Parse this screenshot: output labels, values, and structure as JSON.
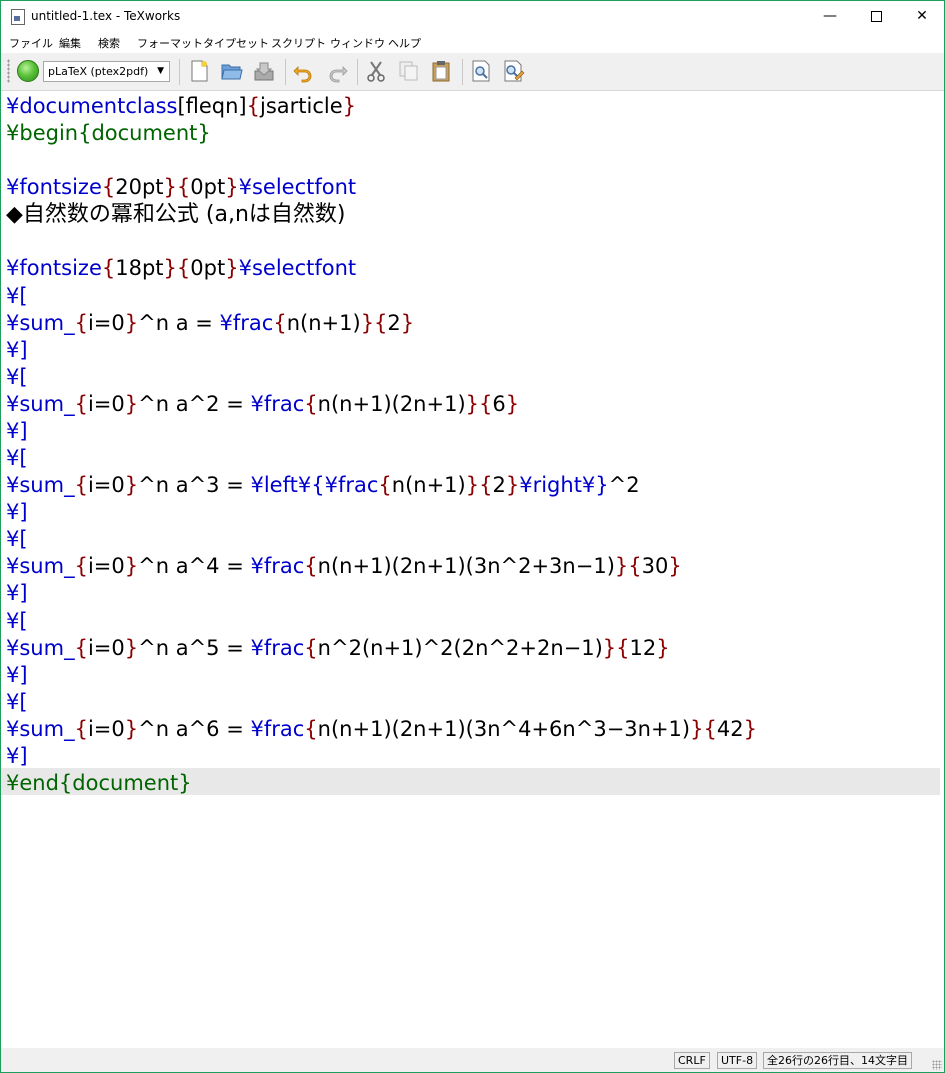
{
  "window": {
    "title": "untitled-1.tex - TeXworks",
    "minimize": "—",
    "close": "✕"
  },
  "menu": {
    "items": [
      "ファイル",
      "編集",
      "検索",
      "フォーマット",
      "タイプセット",
      "スクリプト",
      "ウィンドウ",
      "ヘルプ"
    ]
  },
  "toolbar": {
    "engine": "pLaTeX (ptex2pdf)",
    "engine_arrow": "▼"
  },
  "editor": {
    "lines": [
      [
        {
          "t": "¥documentclass",
          "c": "blue"
        },
        {
          "t": "[fleqn]",
          "c": "black"
        },
        {
          "t": "{",
          "c": "red"
        },
        {
          "t": "jsarticle",
          "c": "black"
        },
        {
          "t": "}",
          "c": "red"
        }
      ],
      [
        {
          "t": "¥begin{document}",
          "c": "green"
        }
      ],
      [],
      [
        {
          "t": "¥fontsize",
          "c": "blue"
        },
        {
          "t": "{",
          "c": "red"
        },
        {
          "t": "20pt",
          "c": "black"
        },
        {
          "t": "}{",
          "c": "red"
        },
        {
          "t": "0pt",
          "c": "black"
        },
        {
          "t": "}",
          "c": "red"
        },
        {
          "t": "¥selectfont",
          "c": "blue"
        }
      ],
      [
        {
          "t": "◆自然数の冪和公式 (a,nは自然数)",
          "c": "black"
        }
      ],
      [],
      [
        {
          "t": "¥fontsize",
          "c": "blue"
        },
        {
          "t": "{",
          "c": "red"
        },
        {
          "t": "18pt",
          "c": "black"
        },
        {
          "t": "}{",
          "c": "red"
        },
        {
          "t": "0pt",
          "c": "black"
        },
        {
          "t": "}",
          "c": "red"
        },
        {
          "t": "¥selectfont",
          "c": "blue"
        }
      ],
      [
        {
          "t": "¥[",
          "c": "blue"
        }
      ],
      [
        {
          "t": "¥sum_",
          "c": "blue"
        },
        {
          "t": "{",
          "c": "red"
        },
        {
          "t": "i=0",
          "c": "black"
        },
        {
          "t": "}",
          "c": "red"
        },
        {
          "t": "^n a = ",
          "c": "black"
        },
        {
          "t": "¥frac",
          "c": "blue"
        },
        {
          "t": "{",
          "c": "red"
        },
        {
          "t": "n(n+1)",
          "c": "black"
        },
        {
          "t": "}{",
          "c": "red"
        },
        {
          "t": "2",
          "c": "black"
        },
        {
          "t": "}",
          "c": "red"
        }
      ],
      [
        {
          "t": "¥]",
          "c": "blue"
        }
      ],
      [
        {
          "t": "¥[",
          "c": "blue"
        }
      ],
      [
        {
          "t": "¥sum_",
          "c": "blue"
        },
        {
          "t": "{",
          "c": "red"
        },
        {
          "t": "i=0",
          "c": "black"
        },
        {
          "t": "}",
          "c": "red"
        },
        {
          "t": "^n a^2 = ",
          "c": "black"
        },
        {
          "t": "¥frac",
          "c": "blue"
        },
        {
          "t": "{",
          "c": "red"
        },
        {
          "t": "n(n+1)(2n+1)",
          "c": "black"
        },
        {
          "t": "}{",
          "c": "red"
        },
        {
          "t": "6",
          "c": "black"
        },
        {
          "t": "}",
          "c": "red"
        }
      ],
      [
        {
          "t": "¥]",
          "c": "blue"
        }
      ],
      [
        {
          "t": "¥[",
          "c": "blue"
        }
      ],
      [
        {
          "t": "¥sum_",
          "c": "blue"
        },
        {
          "t": "{",
          "c": "red"
        },
        {
          "t": "i=0",
          "c": "black"
        },
        {
          "t": "}",
          "c": "red"
        },
        {
          "t": "^n a^3 = ",
          "c": "black"
        },
        {
          "t": "¥left¥{¥frac",
          "c": "blue"
        },
        {
          "t": "{",
          "c": "red"
        },
        {
          "t": "n(n+1)",
          "c": "black"
        },
        {
          "t": "}{",
          "c": "red"
        },
        {
          "t": "2",
          "c": "black"
        },
        {
          "t": "}",
          "c": "red"
        },
        {
          "t": "¥right¥}",
          "c": "blue"
        },
        {
          "t": "^2",
          "c": "black"
        }
      ],
      [
        {
          "t": "¥]",
          "c": "blue"
        }
      ],
      [
        {
          "t": "¥[",
          "c": "blue"
        }
      ],
      [
        {
          "t": "¥sum_",
          "c": "blue"
        },
        {
          "t": "{",
          "c": "red"
        },
        {
          "t": "i=0",
          "c": "black"
        },
        {
          "t": "}",
          "c": "red"
        },
        {
          "t": "^n a^4 = ",
          "c": "black"
        },
        {
          "t": "¥frac",
          "c": "blue"
        },
        {
          "t": "{",
          "c": "red"
        },
        {
          "t": "n(n+1)(2n+1)(3n^2+3n−1)",
          "c": "black"
        },
        {
          "t": "}{",
          "c": "red"
        },
        {
          "t": "30",
          "c": "black"
        },
        {
          "t": "}",
          "c": "red"
        }
      ],
      [
        {
          "t": "¥]",
          "c": "blue"
        }
      ],
      [
        {
          "t": "¥[",
          "c": "blue"
        }
      ],
      [
        {
          "t": "¥sum_",
          "c": "blue"
        },
        {
          "t": "{",
          "c": "red"
        },
        {
          "t": "i=0",
          "c": "black"
        },
        {
          "t": "}",
          "c": "red"
        },
        {
          "t": "^n a^5 = ",
          "c": "black"
        },
        {
          "t": "¥frac",
          "c": "blue"
        },
        {
          "t": "{",
          "c": "red"
        },
        {
          "t": "n^2(n+1)^2(2n^2+2n−1)",
          "c": "black"
        },
        {
          "t": "}{",
          "c": "red"
        },
        {
          "t": "12",
          "c": "black"
        },
        {
          "t": "}",
          "c": "red"
        }
      ],
      [
        {
          "t": "¥]",
          "c": "blue"
        }
      ],
      [
        {
          "t": "¥[",
          "c": "blue"
        }
      ],
      [
        {
          "t": "¥sum_",
          "c": "blue"
        },
        {
          "t": "{",
          "c": "red"
        },
        {
          "t": "i=0",
          "c": "black"
        },
        {
          "t": "}",
          "c": "red"
        },
        {
          "t": "^n a^6 = ",
          "c": "black"
        },
        {
          "t": "¥frac",
          "c": "blue"
        },
        {
          "t": "{",
          "c": "red"
        },
        {
          "t": "n(n+1)(2n+1)(3n^4+6n^3−3n+1)",
          "c": "black"
        },
        {
          "t": "}{",
          "c": "red"
        },
        {
          "t": "42",
          "c": "black"
        },
        {
          "t": "}",
          "c": "red"
        }
      ],
      [
        {
          "t": "¥]",
          "c": "blue"
        }
      ],
      [
        {
          "t": "¥end{document}",
          "c": "green"
        }
      ]
    ]
  },
  "statusbar": {
    "line_ending": "CRLF",
    "encoding": "UTF-8",
    "position": "全26行の26行目、14文字目"
  },
  "colors": {
    "command": "#0000cc",
    "brace": "#8b0000",
    "environment": "#006400",
    "text": "#000000",
    "current_line": "#e8e8e8",
    "window_border": "#1e9e5a"
  },
  "icons": [
    "tex-file-icon",
    "typeset-play-icon",
    "new-document-icon",
    "open-folder-icon",
    "save-icon",
    "undo-icon",
    "redo-icon",
    "cut-icon",
    "copy-icon",
    "paste-icon",
    "find-icon",
    "replace-icon"
  ]
}
